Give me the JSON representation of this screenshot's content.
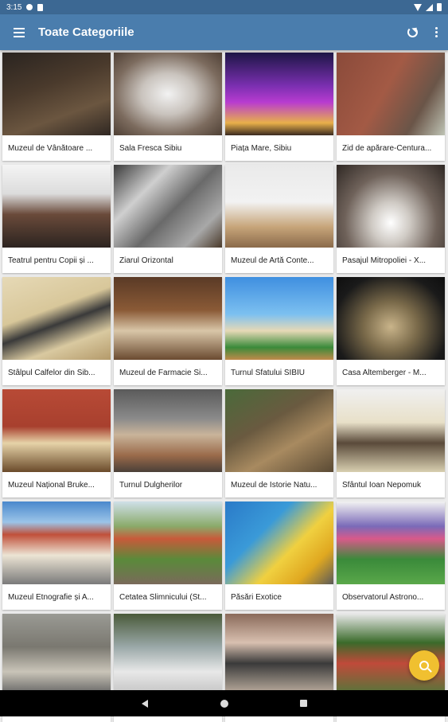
{
  "status_bar": {
    "time": "3:15"
  },
  "app_bar": {
    "title": "Toate Categoriile"
  },
  "cards": [
    {
      "label": "Muzeul de Vânătoare ...",
      "bg": "linear-gradient(160deg,#2a2420 0%,#4a3a2c 40%,#6b5640 70%,#2f2722 100%)"
    },
    {
      "label": "Sala Fresca Sibiu",
      "bg": "radial-gradient(ellipse at 50% 50%,#f2f2f2 0%,#c9c3bd 35%,#7c6b5e 70%,#4f4035 100%)"
    },
    {
      "label": "Piața Mare, Sibiu",
      "bg": "linear-gradient(180deg,#1d1646 0%,#7a2fb0 40%,#b83bd0 60%,#e8b04a 85%,#3a2a20 100%)"
    },
    {
      "label": "Zid de apărare-Centura...",
      "bg": "linear-gradient(120deg,#8a4a3a 0%,#a35a45 45%,#6a5548 75%,#bfc4b5 100%)"
    },
    {
      "label": "Teatrul pentru Copii și ...",
      "bg": "linear-gradient(180deg,#f4f4f4 0%,#dcdcdc 35%,#6a4a3a 60%,#2c2420 100%)"
    },
    {
      "label": "Ziarul Orizontal",
      "bg": "linear-gradient(135deg,#3a3a3a 0%,#cfcfcf 30%,#6a6a6a 55%,#a8a8a8 80%,#4a3a2a 100%)"
    },
    {
      "label": "Muzeul de Artă Conte...",
      "bg": "linear-gradient(180deg,#eaeaea 0%,#f2f2f2 45%,#c7a57a 75%,#8a6a4a 100%)"
    },
    {
      "label": "Pasajul Mitropoliei - X...",
      "bg": "radial-gradient(ellipse at 50% 70%,#ffffff 0%,#cfcac4 25%,#6f625a 60%,#2f2824 100%)"
    },
    {
      "label": "Stâlpul Calfelor din Sib...",
      "bg": "linear-gradient(160deg,#e6d9b6 0%,#d8c79a 40%,#3a3a3a 55%,#d9c9a0 75%,#b49a6a 100%)"
    },
    {
      "label": "Muzeul de Farmacie Si...",
      "bg": "linear-gradient(180deg,#5a3a26 0%,#8a5a36 40%,#d9c6a8 65%,#6a4a30 100%)"
    },
    {
      "label": "Turnul Sfatului SIBIU",
      "bg": "linear-gradient(180deg,#3f8fe0 0%,#7cc0f0 45%,#e6d9b6 65%,#3a8a3a 85%,#c08a4a 100%)"
    },
    {
      "label": "Casa Altemberger - M...",
      "bg": "radial-gradient(ellipse at 50% 60%,#c9b48a 0%,#7a6a4a 35%,#1a1a1a 75%,#0e0e0e 100%)"
    },
    {
      "label": "Muzeul Național Bruke...",
      "bg": "linear-gradient(180deg,#b84a36 0%,#a8402e 45%,#e6d3a8 65%,#6a4a2a 100%)"
    },
    {
      "label": "Turnul Dulgherilor",
      "bg": "linear-gradient(180deg,#5a5a5a 0%,#8a8a8a 35%,#c9b49a 55%,#9a6a4a 80%,#4a4038 100%)"
    },
    {
      "label": "Muzeul de Istorie Natu...",
      "bg": "linear-gradient(150deg,#4a6a3a 0%,#6a5a40 40%,#a88a60 65%,#5a4a34 100%)"
    },
    {
      "label": "Sfântul Ioan Nepomuk",
      "bg": "linear-gradient(180deg,#f0f0f0 0%,#e8e0c8 40%,#5a4a3a 65%,#d8cfb0 100%)"
    },
    {
      "label": "Muzeul Etnografie și A...",
      "bg": "linear-gradient(180deg,#4a88cc 0%,#9bc4e8 25%,#c0503a 40%,#ece4d4 65%,#7a7a7a 100%)"
    },
    {
      "label": "Cetatea Slimnicului (St...",
      "bg": "linear-gradient(180deg,#cfe0e8 0%,#8aaa6a 30%,#c85a3a 45%,#5a8a3a 70%,#7a6a5a 100%)"
    },
    {
      "label": "Păsări Exotice",
      "bg": "linear-gradient(135deg,#2a7ac8 0%,#3a9ad8 35%,#f0d040 60%,#e0a820 80%,#5a5a5a 100%)"
    },
    {
      "label": "Observatorul Astrono...",
      "bg": "linear-gradient(180deg,#f2f2f2 0%,#7a6ab8 30%,#d85a8a 45%,#3a8a3a 70%,#5aa84a 100%)"
    },
    {
      "label": "",
      "bg": "linear-gradient(180deg,#9a9a94 0%,#7a7870 40%,#c9c4b8 70%,#5a5a5a 100%)"
    },
    {
      "label": "",
      "bg": "linear-gradient(180deg,#4a5a3a 0%,#9aa8a8 40%,#e8e8e8 70%,#c0c0c0 100%)"
    },
    {
      "label": "",
      "bg": "linear-gradient(180deg,#8a6a5a 0%,#d8c0b0 35%,#3a3a3a 60%,#c8b8a8 100%)"
    },
    {
      "label": "",
      "bg": "linear-gradient(180deg,#e8e8e8 0%,#3a6a2a 35%,#c04a3a 60%,#4a7a3a 100%)"
    }
  ],
  "fab": {
    "icon": "search-icon"
  },
  "colors": {
    "status_bar": "#3c6893",
    "app_bar": "#4a7dad",
    "fab": "#f0c030"
  }
}
